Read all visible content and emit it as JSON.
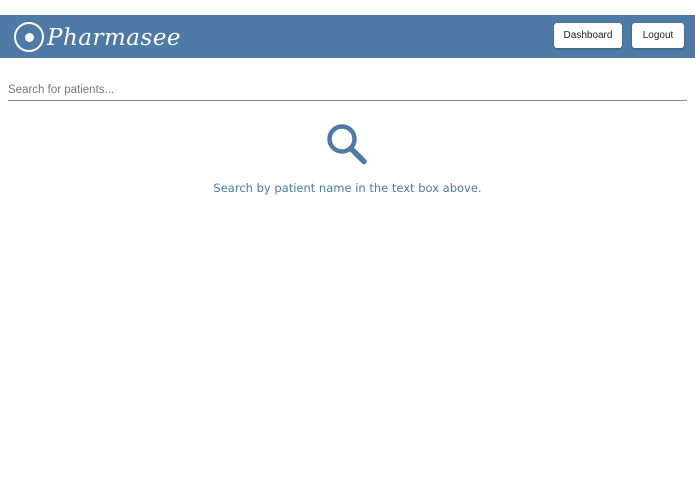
{
  "header": {
    "brand": "Pharmasee",
    "logo_icon": "eye-logo-icon",
    "dashboard_label": "Dashboard",
    "logout_label": "Logout"
  },
  "search": {
    "placeholder": "Search for patients...",
    "value": ""
  },
  "empty_state": {
    "icon": "search-icon",
    "message": "Search by patient name in the text box above."
  },
  "colors": {
    "navbar": "#4e7aa5",
    "accent": "#4e7aa5",
    "button_bg": "#ffffff"
  }
}
